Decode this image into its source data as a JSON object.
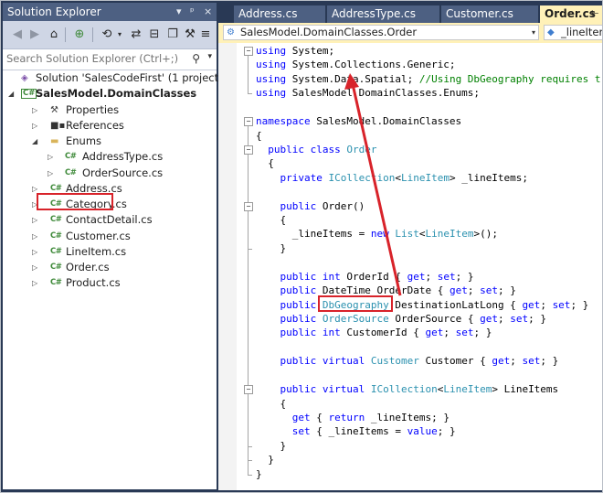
{
  "solution_explorer": {
    "title": "Solution Explorer",
    "title_controls": [
      "▾",
      "ᵖ",
      "×"
    ],
    "search_placeholder": "Search Solution Explorer (Ctrl+;)",
    "tree": [
      {
        "label": "Solution 'SalesCodeFirst' (1 project)",
        "icon": "solution-icon",
        "glyph": "◈",
        "level": 0,
        "arrow": ""
      },
      {
        "label": "SalesModel.DomainClasses",
        "icon": "csharp-project-icon",
        "glyph": "C#",
        "level": 0,
        "arrow": "◢",
        "bold": true
      },
      {
        "label": "Properties",
        "icon": "wrench-icon",
        "glyph": "⚒",
        "level": 1,
        "arrow": "▷"
      },
      {
        "label": "References",
        "icon": "references-icon",
        "glyph": "■▪",
        "level": 1,
        "arrow": "▷"
      },
      {
        "label": "Enums",
        "icon": "folder-icon",
        "glyph": "▬",
        "level": 1,
        "arrow": "◢"
      },
      {
        "label": "AddressType.cs",
        "icon": "csharp-file-icon",
        "glyph": "C#",
        "level": 2,
        "arrow": "▷"
      },
      {
        "label": "OrderSource.cs",
        "icon": "csharp-file-icon",
        "glyph": "C#",
        "level": 2,
        "arrow": "▷"
      },
      {
        "label": "Address.cs",
        "icon": "csharp-file-icon",
        "glyph": "C#",
        "level": 1,
        "arrow": "▷"
      },
      {
        "label": "Category.cs",
        "icon": "csharp-file-icon",
        "glyph": "C#",
        "level": 1,
        "arrow": "▷"
      },
      {
        "label": "ContactDetail.cs",
        "icon": "csharp-file-icon",
        "glyph": "C#",
        "level": 1,
        "arrow": "▷"
      },
      {
        "label": "Customer.cs",
        "icon": "csharp-file-icon",
        "glyph": "C#",
        "level": 1,
        "arrow": "▷"
      },
      {
        "label": "LineItem.cs",
        "icon": "csharp-file-icon",
        "glyph": "C#",
        "level": 1,
        "arrow": "▷"
      },
      {
        "label": "Order.cs",
        "icon": "csharp-file-icon",
        "glyph": "C#",
        "level": 1,
        "arrow": "▷"
      },
      {
        "label": "Product.cs",
        "icon": "csharp-file-icon",
        "glyph": "C#",
        "level": 1,
        "arrow": "▷"
      }
    ]
  },
  "tabs": [
    {
      "label": "Address.cs",
      "active": false
    },
    {
      "label": "AddressType.cs",
      "active": false
    },
    {
      "label": "Customer.cs",
      "active": false
    },
    {
      "label": "Order.cs",
      "active": true,
      "pin": "⊢"
    }
  ],
  "navbar": {
    "type_selector": "SalesModel.DomainClasses.Order",
    "member_selector": "_lineIten"
  },
  "code_lines": [
    [
      [
        "k",
        "using"
      ],
      [
        "p",
        " System;"
      ]
    ],
    [
      [
        "k",
        "using"
      ],
      [
        "p",
        " System.Collections.Generic;"
      ]
    ],
    [
      [
        "k",
        "using"
      ],
      [
        "p",
        " System.Data.Spatial; "
      ],
      [
        "cm",
        "//Using DbGeography requires t"
      ]
    ],
    [
      [
        "k",
        "using"
      ],
      [
        "p",
        " SalesModel.DomainClasses.Enums;"
      ]
    ],
    [],
    [
      [
        "k",
        "namespace"
      ],
      [
        "p",
        " SalesModel.DomainClasses"
      ]
    ],
    [
      [
        "p",
        "{"
      ]
    ],
    [
      [
        "p",
        "  "
      ],
      [
        "k",
        "public"
      ],
      [
        "p",
        " "
      ],
      [
        "k",
        "class"
      ],
      [
        "p",
        " "
      ],
      [
        "ty",
        "Order"
      ]
    ],
    [
      [
        "p",
        "  {"
      ]
    ],
    [
      [
        "p",
        "    "
      ],
      [
        "k",
        "private"
      ],
      [
        "p",
        " "
      ],
      [
        "ty",
        "ICollection"
      ],
      [
        "p",
        "<"
      ],
      [
        "ty",
        "LineItem"
      ],
      [
        "p",
        "> _lineItems;"
      ]
    ],
    [],
    [
      [
        "p",
        "    "
      ],
      [
        "k",
        "public"
      ],
      [
        "p",
        " Order()"
      ]
    ],
    [
      [
        "p",
        "    {"
      ]
    ],
    [
      [
        "p",
        "      _lineItems = "
      ],
      [
        "k",
        "new"
      ],
      [
        "p",
        " "
      ],
      [
        "ty",
        "List"
      ],
      [
        "p",
        "<"
      ],
      [
        "ty",
        "LineItem"
      ],
      [
        "p",
        ">();"
      ]
    ],
    [
      [
        "p",
        "    }"
      ]
    ],
    [],
    [
      [
        "p",
        "    "
      ],
      [
        "k",
        "public"
      ],
      [
        "p",
        " "
      ],
      [
        "k",
        "int"
      ],
      [
        "p",
        " OrderId { "
      ],
      [
        "k",
        "get"
      ],
      [
        "p",
        "; "
      ],
      [
        "k",
        "set"
      ],
      [
        "p",
        "; }"
      ]
    ],
    [
      [
        "p",
        "    "
      ],
      [
        "k",
        "public"
      ],
      [
        "p",
        " DateTime OrderDate { "
      ],
      [
        "k",
        "get"
      ],
      [
        "p",
        "; "
      ],
      [
        "k",
        "set"
      ],
      [
        "p",
        "; }"
      ]
    ],
    [
      [
        "p",
        "    "
      ],
      [
        "k",
        "public"
      ],
      [
        "p",
        " "
      ],
      [
        "ty",
        "DbGeography"
      ],
      [
        "p",
        " DestinationLatLong { "
      ],
      [
        "k",
        "get"
      ],
      [
        "p",
        "; "
      ],
      [
        "k",
        "set"
      ],
      [
        "p",
        "; }"
      ]
    ],
    [
      [
        "p",
        "    "
      ],
      [
        "k",
        "public"
      ],
      [
        "p",
        " "
      ],
      [
        "ty",
        "OrderSource"
      ],
      [
        "p",
        " OrderSource { "
      ],
      [
        "k",
        "get"
      ],
      [
        "p",
        "; "
      ],
      [
        "k",
        "set"
      ],
      [
        "p",
        "; }"
      ]
    ],
    [
      [
        "p",
        "    "
      ],
      [
        "k",
        "public"
      ],
      [
        "p",
        " "
      ],
      [
        "k",
        "int"
      ],
      [
        "p",
        " CustomerId { "
      ],
      [
        "k",
        "get"
      ],
      [
        "p",
        "; "
      ],
      [
        "k",
        "set"
      ],
      [
        "p",
        "; }"
      ]
    ],
    [],
    [
      [
        "p",
        "    "
      ],
      [
        "k",
        "public"
      ],
      [
        "p",
        " "
      ],
      [
        "k",
        "virtual"
      ],
      [
        "p",
        " "
      ],
      [
        "ty",
        "Customer"
      ],
      [
        "p",
        " Customer { "
      ],
      [
        "k",
        "get"
      ],
      [
        "p",
        "; "
      ],
      [
        "k",
        "set"
      ],
      [
        "p",
        "; }"
      ]
    ],
    [],
    [
      [
        "p",
        "    "
      ],
      [
        "k",
        "public"
      ],
      [
        "p",
        " "
      ],
      [
        "k",
        "virtual"
      ],
      [
        "p",
        " "
      ],
      [
        "ty",
        "ICollection"
      ],
      [
        "p",
        "<"
      ],
      [
        "ty",
        "LineItem"
      ],
      [
        "p",
        "> LineItems"
      ]
    ],
    [
      [
        "p",
        "    {"
      ]
    ],
    [
      [
        "p",
        "      "
      ],
      [
        "k",
        "get"
      ],
      [
        "p",
        " { "
      ],
      [
        "k",
        "return"
      ],
      [
        "p",
        " _lineItems; }"
      ]
    ],
    [
      [
        "p",
        "      "
      ],
      [
        "k",
        "set"
      ],
      [
        "p",
        " { _lineItems = "
      ],
      [
        "k",
        "value"
      ],
      [
        "p",
        "; }"
      ]
    ],
    [
      [
        "p",
        "    }"
      ]
    ],
    [
      [
        "p",
        "  }"
      ]
    ],
    [
      [
        "p",
        "}"
      ]
    ]
  ],
  "colors": {
    "keyword": "#0000ff",
    "type": "#2b91af",
    "comment": "#008000",
    "highlight": "#d8232a",
    "chrome": "#293955"
  }
}
